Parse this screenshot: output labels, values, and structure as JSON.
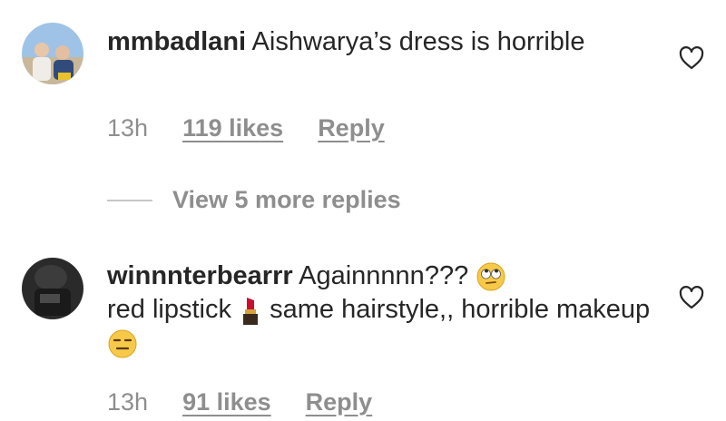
{
  "comments": [
    {
      "username": "mmbadlani",
      "text": " Aishwarya’s dress is horrible",
      "time": "13h",
      "likes": "119 likes",
      "reply_label": "Reply"
    },
    {
      "username": "winnnterbearrr",
      "text_part1": " Againnnnn??? ",
      "text_part2": "red lipstick ",
      "text_part3": " same hairstyle,, horrible makeup ",
      "time": "13h",
      "likes": "91 likes",
      "reply_label": "Reply"
    }
  ],
  "view_replies_label": "View 5 more replies",
  "icons": {
    "like": "heart-outline-icon",
    "emoji1": "face-with-rolling-eyes-emoji",
    "emoji2": "lipstick-emoji",
    "emoji3": "expressionless-face-emoji"
  },
  "colors": {
    "text": "#262626",
    "secondary": "#8e8e8e",
    "background": "#ffffff"
  }
}
